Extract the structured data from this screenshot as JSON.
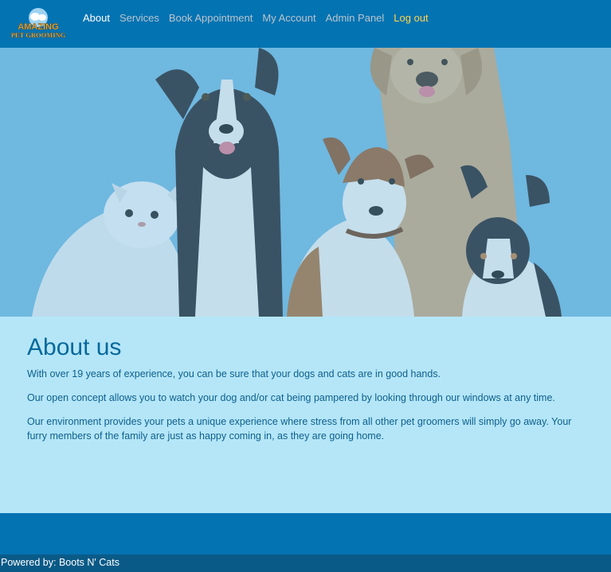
{
  "logo": {
    "line1": "AMAZING",
    "line2": "PET GROOMING"
  },
  "nav": [
    {
      "label": "About"
    },
    {
      "label": "Services"
    },
    {
      "label": "Book Appointment"
    },
    {
      "label": "My Account"
    },
    {
      "label": "Admin Panel"
    },
    {
      "label": "Log out"
    }
  ],
  "content": {
    "heading": "About us",
    "paragraphs": [
      "With over 19 years of experience, you can be sure that your dogs and cats are in good hands.",
      "Our open concept allows you to watch your dog and/or cat being pampered by looking through our windows at any time.",
      "Our environment provides your pets a unique experience where stress from all other pet groomers will simply go away. Your furry members of the family are just as happy coming in, as they are going home."
    ]
  },
  "footer": {
    "text": "Powered by: Boots N' Cats"
  },
  "colors": {
    "primary": "#0473b2",
    "content_bg": "#b4e6f8",
    "heading": "#07689b",
    "logout": "#ffd54a"
  }
}
